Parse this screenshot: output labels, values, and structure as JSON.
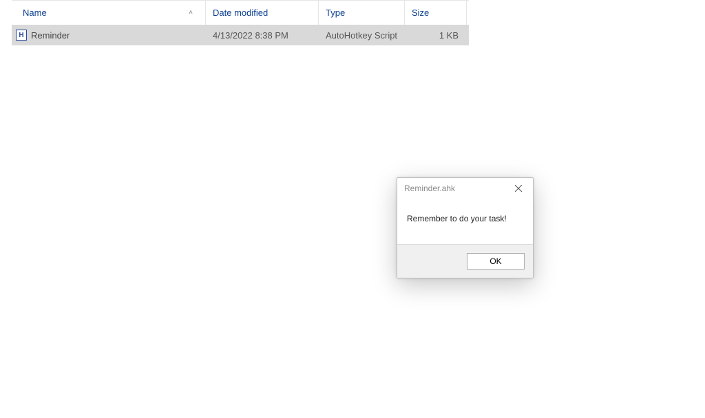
{
  "columns": {
    "name": "Name",
    "date": "Date modified",
    "type": "Type",
    "size": "Size"
  },
  "rows": [
    {
      "icon_letter": "H",
      "name": "Reminder",
      "date": "4/13/2022 8:38 PM",
      "type": "AutoHotkey Script",
      "size": "1 KB"
    }
  ],
  "dialog": {
    "title": "Reminder.ahk",
    "message": "Remember to do your task!",
    "ok_label": "OK"
  }
}
